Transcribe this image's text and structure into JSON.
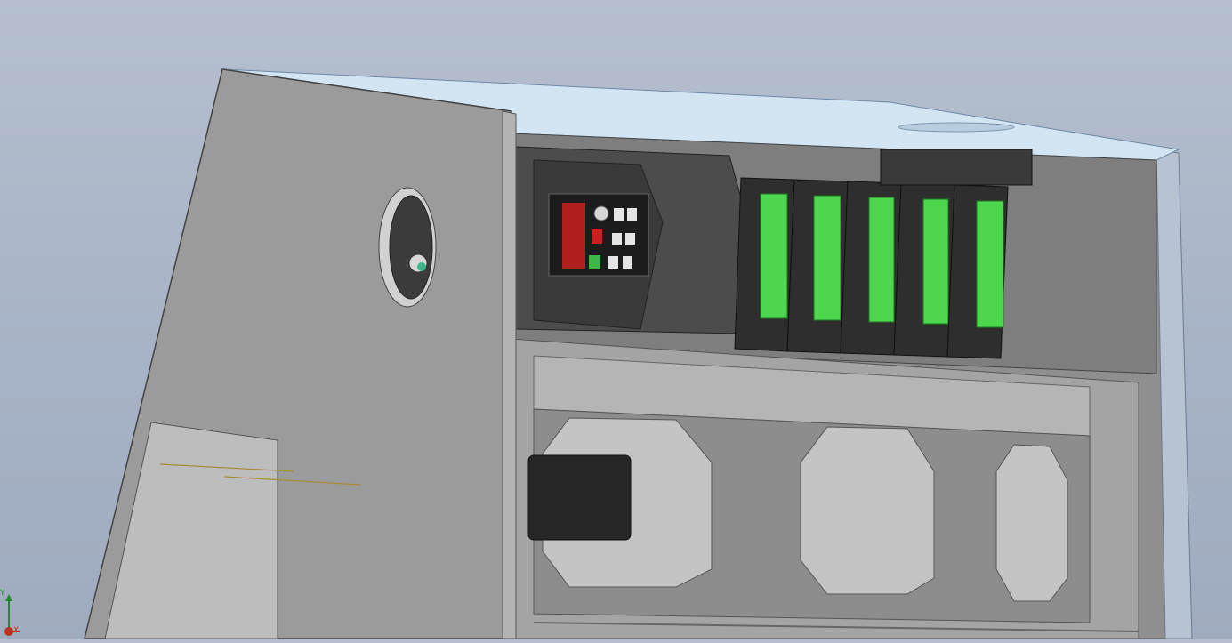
{
  "viewport": {
    "background": "#a9b5c8",
    "model": "electrical-enclosure-assembly"
  },
  "triad": {
    "y_label": "Y",
    "x_label": "X",
    "y_color": "#1e8a2a",
    "x_color": "#c0301e"
  },
  "colors": {
    "enclosure": "#9a9a9a",
    "door": "#999999",
    "glass_lid": "#cfe2f2",
    "drive_body": "#4a4a4a",
    "keypad_display": "#b21f1f",
    "terminal_green": "#4fd64f",
    "rail_frame": "#a8a8a8"
  }
}
